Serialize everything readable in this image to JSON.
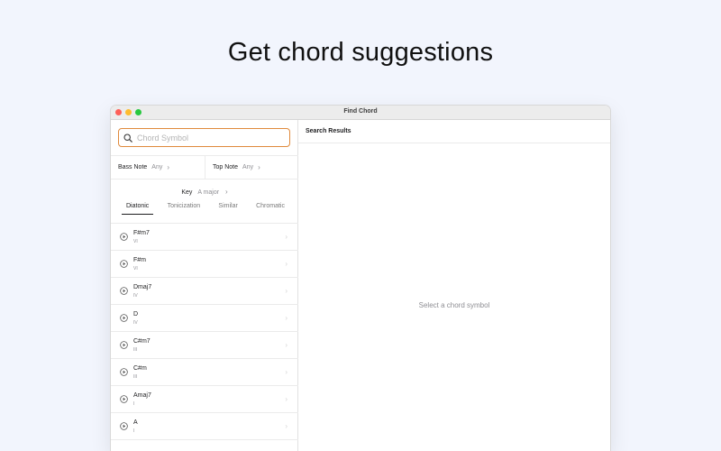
{
  "headline": "Get chord suggestions",
  "window": {
    "title": "Find Chord"
  },
  "search": {
    "placeholder": "Chord Symbol",
    "value": ""
  },
  "filters": {
    "bass_note": {
      "label": "Bass Note",
      "value": "Any"
    },
    "top_note": {
      "label": "Top Note",
      "value": "Any"
    }
  },
  "key": {
    "label": "Key",
    "value": "A major"
  },
  "tabs": [
    {
      "label": "Diatonic",
      "active": true
    },
    {
      "label": "Tonicization",
      "active": false
    },
    {
      "label": "Similar",
      "active": false
    },
    {
      "label": "Chromatic",
      "active": false
    }
  ],
  "chords": [
    {
      "name": "F#m7",
      "roman": "VI"
    },
    {
      "name": "F#m",
      "roman": "VI"
    },
    {
      "name": "Dmaj7",
      "roman": "IV"
    },
    {
      "name": "D",
      "roman": "IV"
    },
    {
      "name": "C#m7",
      "roman": "III"
    },
    {
      "name": "C#m",
      "roman": "III"
    },
    {
      "name": "Amaj7",
      "roman": "I"
    },
    {
      "name": "A",
      "roman": "I"
    }
  ],
  "results": {
    "header": "Search Results",
    "empty_text": "Select a chord symbol"
  },
  "icons": {
    "search": "search-icon",
    "play": "play-circle-icon",
    "chevron": "chevron-right-icon"
  },
  "colors": {
    "background": "#f2f5fd",
    "search_focus": "#e08a3c",
    "traffic_red": "#fe5f57",
    "traffic_yellow": "#febc2e",
    "traffic_green": "#28c840"
  }
}
